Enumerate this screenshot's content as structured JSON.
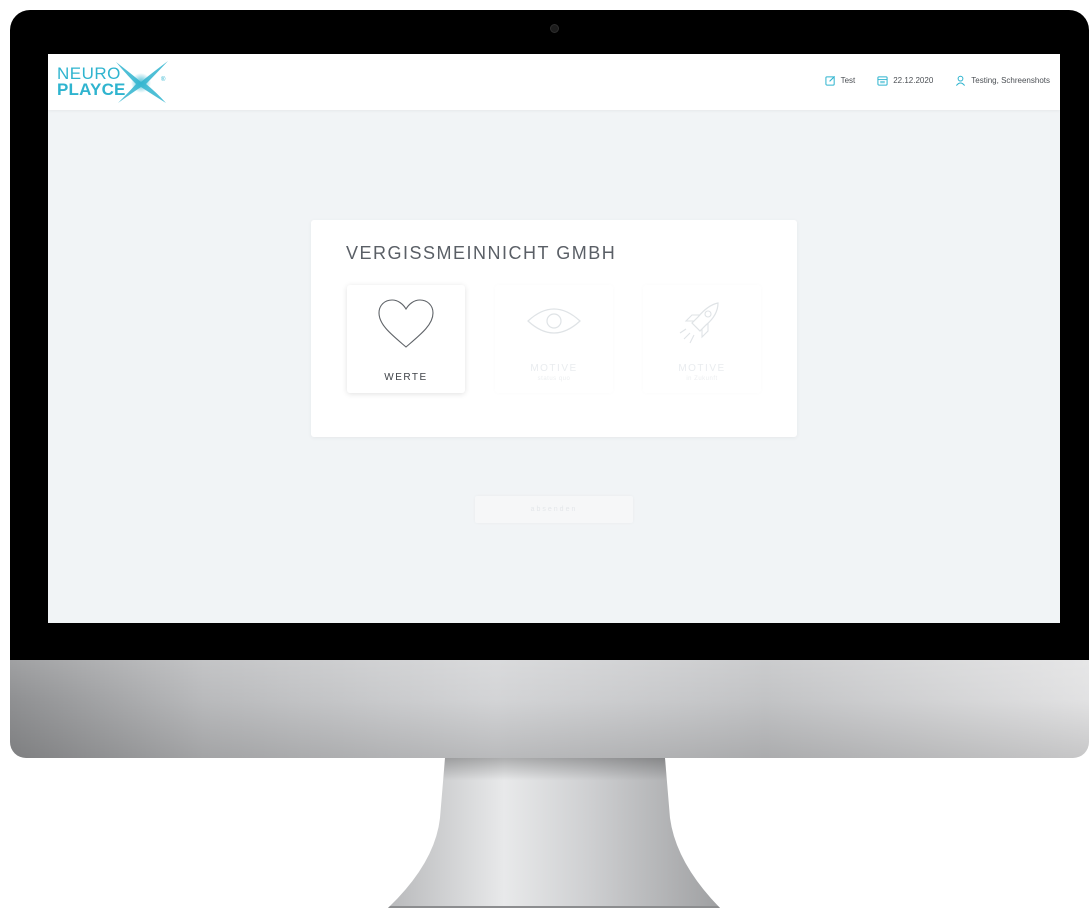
{
  "brand": {
    "line1": "NEURO",
    "line2": "PLAYCE",
    "registered": "®",
    "color": "#2fb4cf"
  },
  "header": {
    "items": [
      {
        "icon": "edit-square-icon",
        "label": "Test"
      },
      {
        "icon": "calendar-icon",
        "label": "22.12.2020"
      },
      {
        "icon": "user-icon",
        "label": "Testing, Schreenshots"
      }
    ]
  },
  "card": {
    "company": "VERGISSMEINNICHT GMBH",
    "tiles": [
      {
        "icon": "heart-icon",
        "label": "WERTE",
        "sub": "",
        "state": "active"
      },
      {
        "icon": "eye-icon",
        "label": "MOTIVE",
        "sub": "status quo",
        "state": "disabled"
      },
      {
        "icon": "rocket-icon",
        "label": "MOTIVE",
        "sub": "in Zukunft",
        "state": "disabled"
      }
    ]
  },
  "actions": {
    "submit_label": "absenden"
  }
}
